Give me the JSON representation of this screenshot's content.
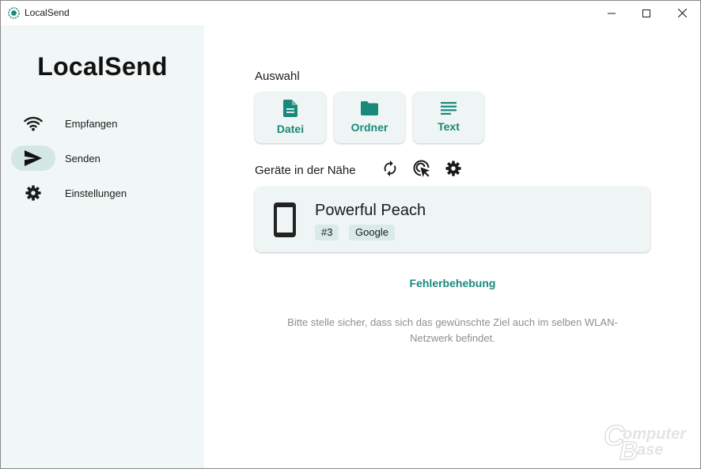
{
  "window": {
    "title": "LocalSend"
  },
  "sidebar": {
    "brand": "LocalSend",
    "items": [
      {
        "label": "Empfangen",
        "icon": "wifi-icon",
        "active": false
      },
      {
        "label": "Senden",
        "icon": "send-icon",
        "active": true
      },
      {
        "label": "Einstellungen",
        "icon": "gear-icon",
        "active": false
      }
    ]
  },
  "main": {
    "selection_title": "Auswahl",
    "selection_buttons": [
      {
        "label": "Datei",
        "icon": "file-icon"
      },
      {
        "label": "Ordner",
        "icon": "folder-icon"
      },
      {
        "label": "Text",
        "icon": "text-icon"
      }
    ],
    "nearby_title": "Geräte in der Nähe",
    "nearby_tools": [
      "refresh-icon",
      "cursor-icon",
      "gear-icon"
    ],
    "devices": [
      {
        "name": "Powerful Peach",
        "tags": [
          "#3",
          "Google"
        ],
        "icon": "phone-icon"
      }
    ],
    "troubleshoot_label": "Fehlerbehebung",
    "hint_line1": "Bitte stelle sicher, dass sich das gewünschte Ziel auch im selben WLAN-",
    "hint_line2": "Netzwerk befindet."
  },
  "watermark": {
    "line1": "omputer",
    "line2": "ase",
    "letter1": "C",
    "letter2": "B"
  },
  "colors": {
    "accent": "#18897a",
    "sidebar_bg": "#f1f7f6",
    "card_bg": "#eef5f4",
    "tag_bg": "#d8ebe8",
    "active_pill": "#d4e7e4"
  }
}
